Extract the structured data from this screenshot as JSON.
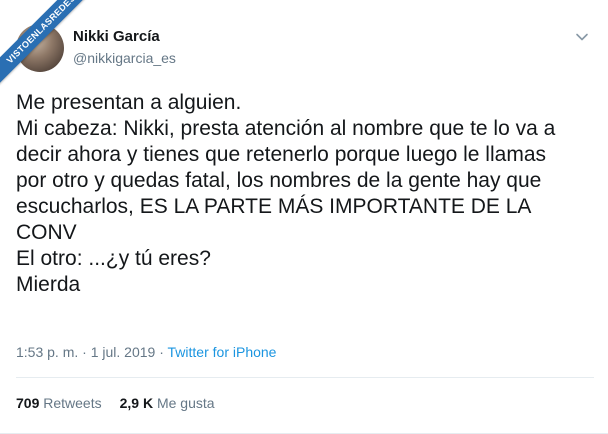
{
  "watermark": "VISTOENLASREDES",
  "author": {
    "name": "Nikki García",
    "handle": "@nikkigarcia_es"
  },
  "tweet": {
    "lines": [
      "Me presentan a alguien.",
      "Mi cabeza: Nikki, presta atención al nombre que te lo va a",
      "decir ahora y tienes que retenerlo porque luego le llamas",
      "por otro y quedas fatal, los nombres de la gente hay que",
      "escucharlos, ES LA PARTE MÁS IMPORTANTE DE LA",
      "CONV",
      "El otro: ...¿y tú eres?",
      "Mierda"
    ]
  },
  "meta": {
    "time": "1:53 p. m.",
    "sep1": " · ",
    "date": "1 jul. 2019",
    "sep2": " · ",
    "source": "Twitter for iPhone"
  },
  "stats": {
    "retweets_count": "709",
    "retweets_label": "Retweets",
    "likes_count": "2,9 K",
    "likes_label": "Me gusta"
  },
  "icons": {
    "menu": "chevron-down-icon"
  },
  "colors": {
    "link": "#1b95e0",
    "secondary": "#657786",
    "watermark_bg": "#2a6fb3"
  }
}
